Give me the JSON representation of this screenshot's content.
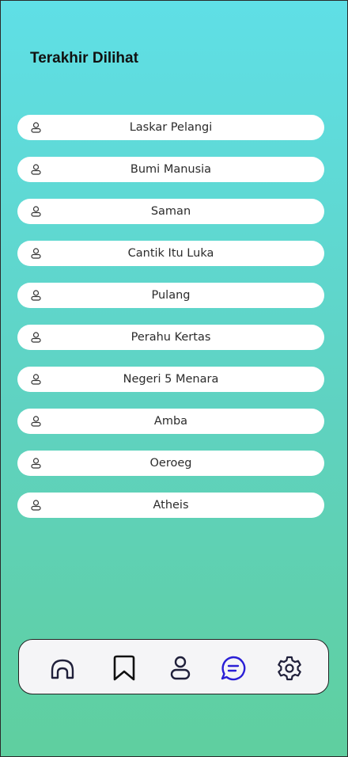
{
  "header": {
    "title": "Terakhir Dilihat"
  },
  "recent_items": [
    {
      "label": "Laskar Pelangi",
      "icon": "user-icon"
    },
    {
      "label": "Bumi Manusia",
      "icon": "user-icon"
    },
    {
      "label": "Saman",
      "icon": "user-icon"
    },
    {
      "label": "Cantik Itu Luka",
      "icon": "user-icon"
    },
    {
      "label": "Pulang",
      "icon": "user-icon"
    },
    {
      "label": "Perahu Kertas",
      "icon": "user-icon"
    },
    {
      "label": "Negeri 5 Menara",
      "icon": "user-icon"
    },
    {
      "label": "Amba",
      "icon": "user-icon"
    },
    {
      "label": "Oeroeg",
      "icon": "user-icon"
    },
    {
      "label": "Atheis",
      "icon": "user-icon"
    }
  ],
  "bottom_nav": {
    "items": [
      {
        "icon": "home-icon",
        "active": false
      },
      {
        "icon": "bookmark-icon",
        "active": false
      },
      {
        "icon": "profile-icon",
        "active": false
      },
      {
        "icon": "chat-icon",
        "active": true
      },
      {
        "icon": "settings-gear-icon",
        "active": false
      }
    ],
    "active_color": "#2a1fd6",
    "inactive_color": "#1f1f3a"
  },
  "colors": {
    "gradient_top": "#5fdfe6",
    "gradient_bottom": "#5fcf9f",
    "item_background": "#ffffff"
  }
}
